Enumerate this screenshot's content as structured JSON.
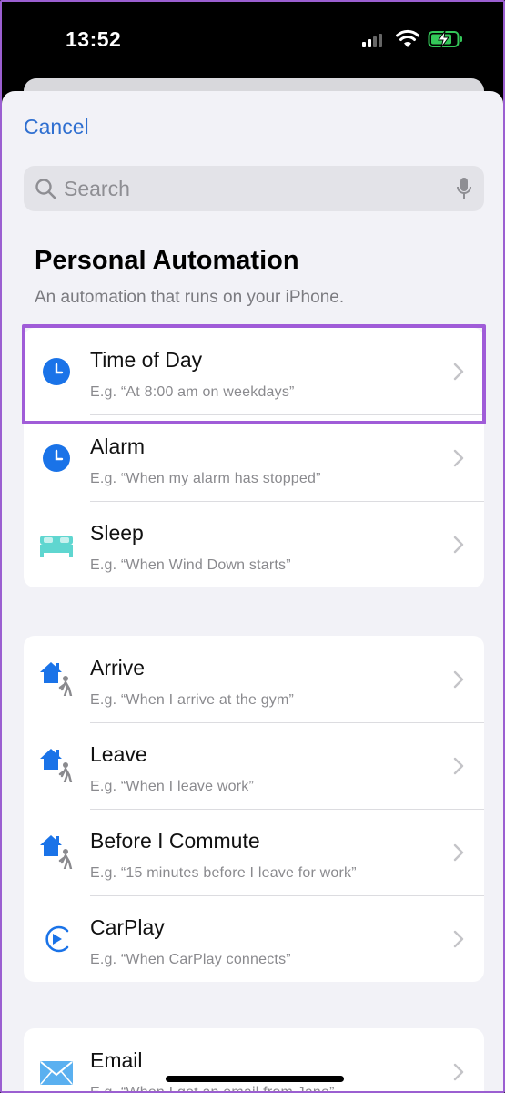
{
  "status_bar": {
    "time": "13:52"
  },
  "header": {
    "cancel_label": "Cancel"
  },
  "search": {
    "placeholder": "Search"
  },
  "section": {
    "title": "Personal Automation",
    "subtitle": "An automation that runs on your iPhone."
  },
  "group1": [
    {
      "icon": "clock-icon",
      "title": "Time of Day",
      "subtitle": "E.g. “At 8:00 am on weekdays”",
      "highlighted": true
    },
    {
      "icon": "clock-icon",
      "title": "Alarm",
      "subtitle": "E.g. “When my alarm has stopped”"
    },
    {
      "icon": "bed-icon",
      "title": "Sleep",
      "subtitle": "E.g. “When Wind Down starts”"
    }
  ],
  "group2": [
    {
      "icon": "home-person-icon",
      "title": "Arrive",
      "subtitle": "E.g. “When I arrive at the gym”"
    },
    {
      "icon": "home-person-icon",
      "title": "Leave",
      "subtitle": "E.g. “When I leave work”"
    },
    {
      "icon": "home-person-icon",
      "title": "Before I Commute",
      "subtitle": "E.g. “15 minutes before I leave for work”"
    },
    {
      "icon": "carplay-icon",
      "title": "CarPlay",
      "subtitle": "E.g. “When CarPlay connects”"
    }
  ],
  "group3": [
    {
      "icon": "mail-icon",
      "title": "Email",
      "subtitle": "E.g. “When I get an email from Jane”"
    }
  ],
  "colors": {
    "accent": "#2f6fd0",
    "highlight": "#a05cd8",
    "sheet_bg": "#f2f2f7"
  }
}
